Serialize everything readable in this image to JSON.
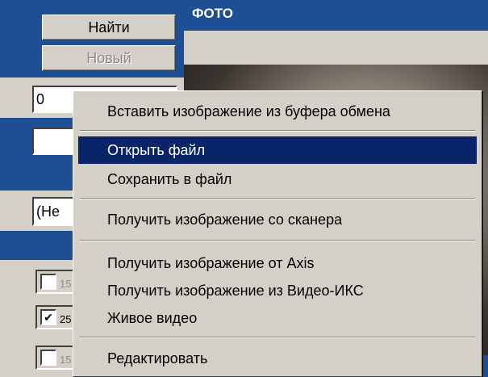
{
  "left": {
    "find_button": "Найти",
    "new_button": "Новый",
    "id_field_value": "0",
    "combo_value": "(Не",
    "checkboxes": [
      {
        "checked": false,
        "label": "15"
      },
      {
        "checked": true,
        "label": "25"
      },
      {
        "checked": false,
        "label": "15"
      }
    ]
  },
  "photo": {
    "header_title": "ФОТО"
  },
  "context_menu": {
    "items": [
      {
        "label": "Вставить изображение из буфера обмена",
        "selected": false
      },
      {
        "label": "Открыть файл",
        "selected": true
      },
      {
        "label": "Сохранить в файл",
        "selected": false
      },
      {
        "label": "Получить изображение со сканера",
        "selected": false
      },
      {
        "label": "Получить изображение от Axis",
        "selected": false
      },
      {
        "label": "Получить изображение из Видео-ИКС",
        "selected": false
      },
      {
        "label": "Живое видео",
        "selected": false
      },
      {
        "label": "Редактировать",
        "selected": false
      }
    ]
  },
  "colors": {
    "panel_blue": "#1e4f94",
    "selection": "#0a246a",
    "face": "#d4d0c8"
  }
}
